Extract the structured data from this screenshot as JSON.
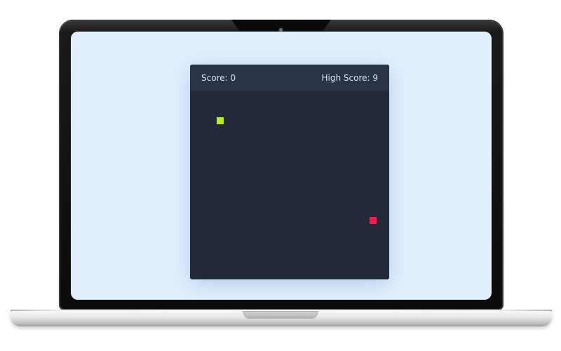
{
  "game": {
    "score_text": "Score: 0",
    "high_score_text": "High Score: 9"
  },
  "colors": {
    "screen_background": "#e2f0fd",
    "game_background": "#232938",
    "header_background": "#2b3446",
    "snake": "#b6f018",
    "food": "#ff1847"
  }
}
